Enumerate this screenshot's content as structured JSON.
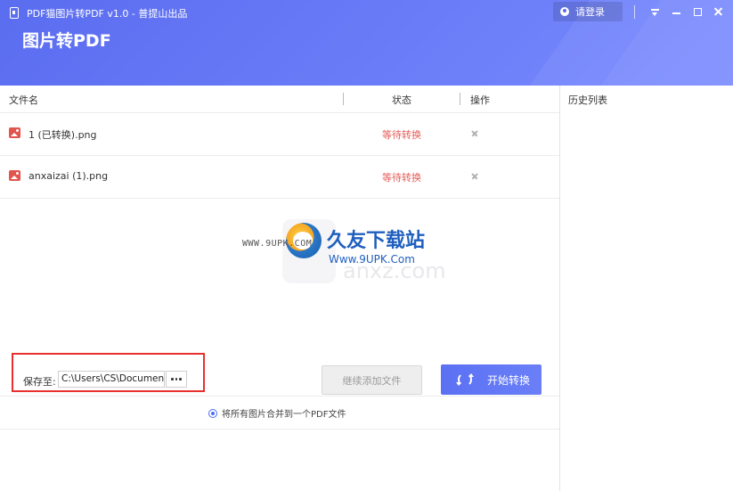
{
  "window": {
    "title": "PDF猫图片转PDF v1.0 - 普提山出品",
    "page_heading": "图片转PDF",
    "login_label": "请登录",
    "colors": {
      "header": "#5b6df0",
      "accent": "#5b71f3",
      "status_waiting": "#e35c57",
      "highlight_box": "#e8312f"
    }
  },
  "table": {
    "columns": [
      "文件名",
      "状态",
      "操作"
    ],
    "rows": [
      {
        "name": "1 (已转换).png",
        "status": "等待转换",
        "action_icon": "close-icon"
      },
      {
        "name": "anxaizai (1).png",
        "status": "等待转换",
        "action_icon": "close-icon"
      }
    ]
  },
  "history": {
    "title": "历史列表"
  },
  "watermark": {
    "url_left": "WWW.9UPK.COM",
    "title": "久友下载站",
    "url": "Www.9UPK.Com",
    "ghost_text": "anxz.com"
  },
  "merge_option": {
    "label": "将所有图片合并到一个PDF文件",
    "selected": true
  },
  "save": {
    "label": "保存至:",
    "path": "C:\\Users\\CS\\Documents"
  },
  "buttons": {
    "continue_add": "继续添加文件",
    "start_convert": "开始转换"
  }
}
